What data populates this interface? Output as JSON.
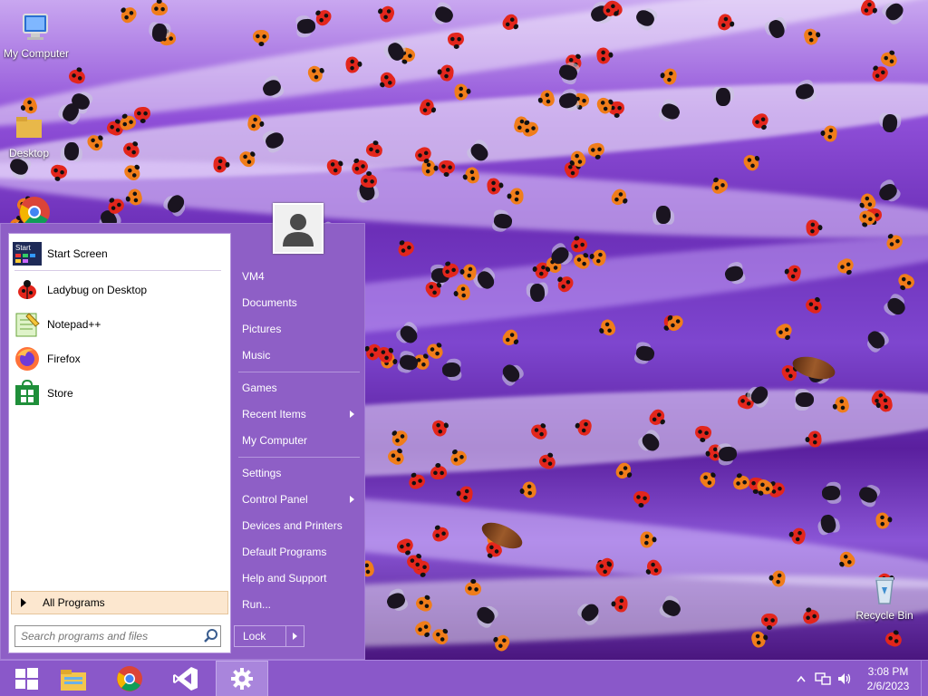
{
  "desktop": {
    "icons": [
      {
        "label": "My Computer"
      },
      {
        "label": "Desktop"
      },
      {
        "label": "Google Chrome"
      },
      {
        "label": "Recycle Bin"
      }
    ]
  },
  "start_menu": {
    "pinned": [
      {
        "label": "Start Screen",
        "icon": "start-screen-icon"
      },
      {
        "label": "Ladybug on Desktop",
        "icon": "ladybug-icon"
      },
      {
        "label": "Notepad++",
        "icon": "notepadpp-icon"
      },
      {
        "label": "Firefox",
        "icon": "firefox-icon"
      },
      {
        "label": "Store",
        "icon": "store-icon"
      }
    ],
    "start_tile_text": "Start",
    "all_programs": "All Programs",
    "search_placeholder": "Search programs and files",
    "right_links": [
      {
        "label": "VM4"
      },
      {
        "label": "Documents"
      },
      {
        "label": "Pictures"
      },
      {
        "label": "Music"
      },
      {
        "label": "Games"
      },
      {
        "label": "Recent Items",
        "has_submenu": true
      },
      {
        "label": "My Computer"
      },
      {
        "label": "Settings"
      },
      {
        "label": "Control Panel",
        "has_submenu": true
      },
      {
        "label": "Devices and Printers"
      },
      {
        "label": "Default Programs"
      },
      {
        "label": "Help and Support"
      },
      {
        "label": "Run..."
      }
    ],
    "lock_label": "Lock"
  },
  "taskbar": {
    "buttons": [
      {
        "name": "windows-start-icon"
      },
      {
        "name": "file-explorer-icon"
      },
      {
        "name": "chrome-icon"
      },
      {
        "name": "visual-studio-icon"
      },
      {
        "name": "settings-gear-icon",
        "active": true
      }
    ],
    "clock": {
      "time": "3:08 PM",
      "date": "2/6/2023"
    }
  },
  "colors": {
    "menu_bg": "#8e5fc6",
    "taskbar_bg": "#8a58c9",
    "all_programs_bg": "#fce7cf"
  }
}
